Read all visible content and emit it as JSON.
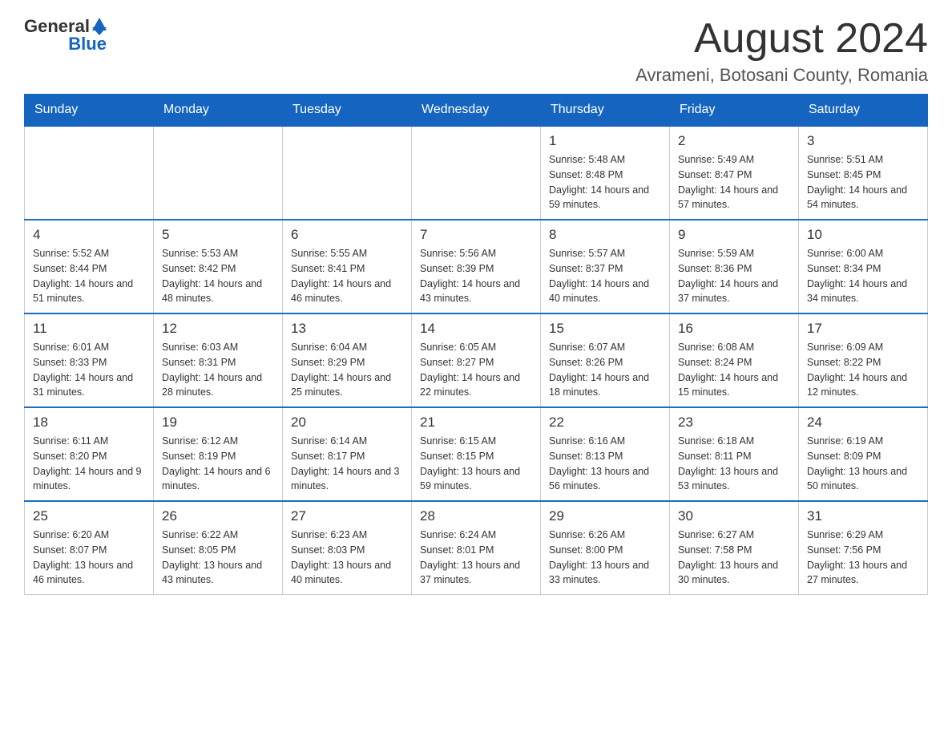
{
  "header": {
    "logo_general": "General",
    "logo_blue": "Blue",
    "month_title": "August 2024",
    "location": "Avrameni, Botosani County, Romania"
  },
  "weekdays": [
    "Sunday",
    "Monday",
    "Tuesday",
    "Wednesday",
    "Thursday",
    "Friday",
    "Saturday"
  ],
  "weeks": [
    [
      {
        "day": "",
        "info": ""
      },
      {
        "day": "",
        "info": ""
      },
      {
        "day": "",
        "info": ""
      },
      {
        "day": "",
        "info": ""
      },
      {
        "day": "1",
        "info": "Sunrise: 5:48 AM\nSunset: 8:48 PM\nDaylight: 14 hours and 59 minutes."
      },
      {
        "day": "2",
        "info": "Sunrise: 5:49 AM\nSunset: 8:47 PM\nDaylight: 14 hours and 57 minutes."
      },
      {
        "day": "3",
        "info": "Sunrise: 5:51 AM\nSunset: 8:45 PM\nDaylight: 14 hours and 54 minutes."
      }
    ],
    [
      {
        "day": "4",
        "info": "Sunrise: 5:52 AM\nSunset: 8:44 PM\nDaylight: 14 hours and 51 minutes."
      },
      {
        "day": "5",
        "info": "Sunrise: 5:53 AM\nSunset: 8:42 PM\nDaylight: 14 hours and 48 minutes."
      },
      {
        "day": "6",
        "info": "Sunrise: 5:55 AM\nSunset: 8:41 PM\nDaylight: 14 hours and 46 minutes."
      },
      {
        "day": "7",
        "info": "Sunrise: 5:56 AM\nSunset: 8:39 PM\nDaylight: 14 hours and 43 minutes."
      },
      {
        "day": "8",
        "info": "Sunrise: 5:57 AM\nSunset: 8:37 PM\nDaylight: 14 hours and 40 minutes."
      },
      {
        "day": "9",
        "info": "Sunrise: 5:59 AM\nSunset: 8:36 PM\nDaylight: 14 hours and 37 minutes."
      },
      {
        "day": "10",
        "info": "Sunrise: 6:00 AM\nSunset: 8:34 PM\nDaylight: 14 hours and 34 minutes."
      }
    ],
    [
      {
        "day": "11",
        "info": "Sunrise: 6:01 AM\nSunset: 8:33 PM\nDaylight: 14 hours and 31 minutes."
      },
      {
        "day": "12",
        "info": "Sunrise: 6:03 AM\nSunset: 8:31 PM\nDaylight: 14 hours and 28 minutes."
      },
      {
        "day": "13",
        "info": "Sunrise: 6:04 AM\nSunset: 8:29 PM\nDaylight: 14 hours and 25 minutes."
      },
      {
        "day": "14",
        "info": "Sunrise: 6:05 AM\nSunset: 8:27 PM\nDaylight: 14 hours and 22 minutes."
      },
      {
        "day": "15",
        "info": "Sunrise: 6:07 AM\nSunset: 8:26 PM\nDaylight: 14 hours and 18 minutes."
      },
      {
        "day": "16",
        "info": "Sunrise: 6:08 AM\nSunset: 8:24 PM\nDaylight: 14 hours and 15 minutes."
      },
      {
        "day": "17",
        "info": "Sunrise: 6:09 AM\nSunset: 8:22 PM\nDaylight: 14 hours and 12 minutes."
      }
    ],
    [
      {
        "day": "18",
        "info": "Sunrise: 6:11 AM\nSunset: 8:20 PM\nDaylight: 14 hours and 9 minutes."
      },
      {
        "day": "19",
        "info": "Sunrise: 6:12 AM\nSunset: 8:19 PM\nDaylight: 14 hours and 6 minutes."
      },
      {
        "day": "20",
        "info": "Sunrise: 6:14 AM\nSunset: 8:17 PM\nDaylight: 14 hours and 3 minutes."
      },
      {
        "day": "21",
        "info": "Sunrise: 6:15 AM\nSunset: 8:15 PM\nDaylight: 13 hours and 59 minutes."
      },
      {
        "day": "22",
        "info": "Sunrise: 6:16 AM\nSunset: 8:13 PM\nDaylight: 13 hours and 56 minutes."
      },
      {
        "day": "23",
        "info": "Sunrise: 6:18 AM\nSunset: 8:11 PM\nDaylight: 13 hours and 53 minutes."
      },
      {
        "day": "24",
        "info": "Sunrise: 6:19 AM\nSunset: 8:09 PM\nDaylight: 13 hours and 50 minutes."
      }
    ],
    [
      {
        "day": "25",
        "info": "Sunrise: 6:20 AM\nSunset: 8:07 PM\nDaylight: 13 hours and 46 minutes."
      },
      {
        "day": "26",
        "info": "Sunrise: 6:22 AM\nSunset: 8:05 PM\nDaylight: 13 hours and 43 minutes."
      },
      {
        "day": "27",
        "info": "Sunrise: 6:23 AM\nSunset: 8:03 PM\nDaylight: 13 hours and 40 minutes."
      },
      {
        "day": "28",
        "info": "Sunrise: 6:24 AM\nSunset: 8:01 PM\nDaylight: 13 hours and 37 minutes."
      },
      {
        "day": "29",
        "info": "Sunrise: 6:26 AM\nSunset: 8:00 PM\nDaylight: 13 hours and 33 minutes."
      },
      {
        "day": "30",
        "info": "Sunrise: 6:27 AM\nSunset: 7:58 PM\nDaylight: 13 hours and 30 minutes."
      },
      {
        "day": "31",
        "info": "Sunrise: 6:29 AM\nSunset: 7:56 PM\nDaylight: 13 hours and 27 minutes."
      }
    ]
  ]
}
